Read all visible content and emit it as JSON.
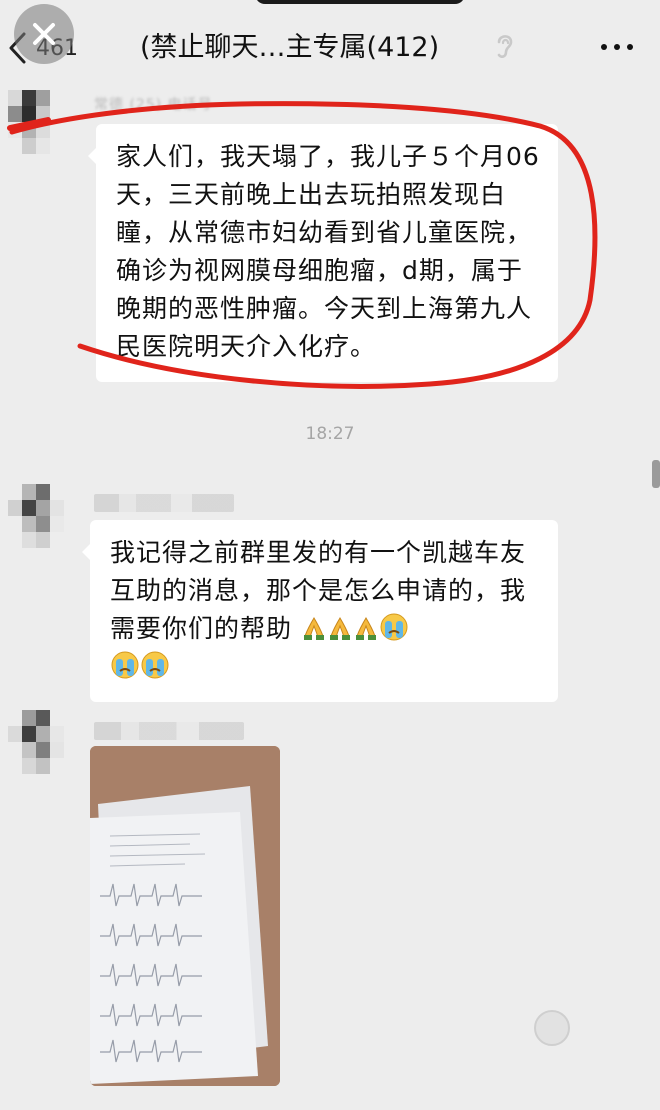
{
  "header": {
    "back_count": "461",
    "title": "(禁止聊天…主专属(412)"
  },
  "messages": [
    {
      "sender": "常德 (25) 电话号",
      "text": "家人们，我天塌了，我儿子５个月06天，三天前晚上出去玩拍照发现白瞳，从常德市妇幼看到省儿童医院，确诊为视网膜母细胞瘤，d期，属于晚期的恶性肿瘤。今天到上海第九人民医院明天介入化疗。"
    },
    {
      "text": "我记得之前群里发的有一个凯越车友互助的消息，那个是怎么申请的，我需要你们的帮助"
    }
  ],
  "timestamp": "18:27",
  "colors": {
    "background": "#ededed",
    "bubble": "#ffffff",
    "annotation": "#e0241b"
  },
  "icons": [
    "close-icon",
    "back-chevron-icon",
    "ear-icon",
    "more-icon",
    "pray-emoji",
    "crying-emoji"
  ]
}
